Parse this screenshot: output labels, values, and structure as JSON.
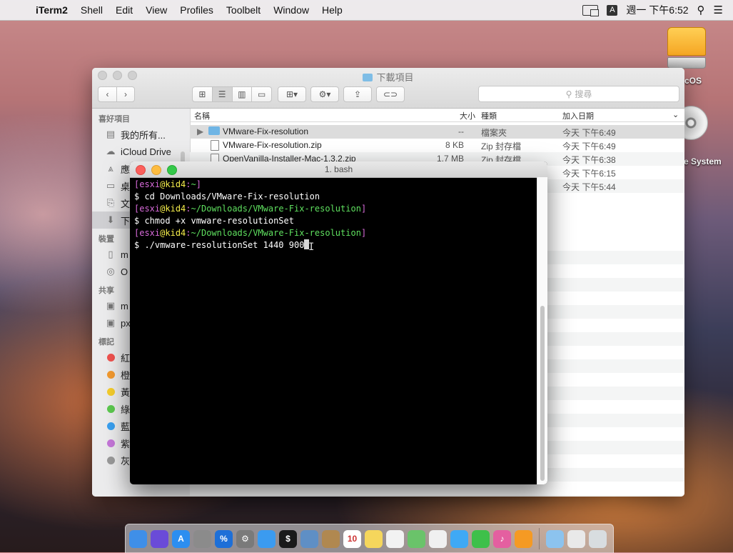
{
  "menubar": {
    "apple": "",
    "app_name": "iTerm2",
    "items": [
      "Shell",
      "Edit",
      "View",
      "Profiles",
      "Toolbelt",
      "Window",
      "Help"
    ],
    "input_method": "A",
    "clock": "週一 下午6:52"
  },
  "desktop": {
    "hd_label": "cOS",
    "disc_label": "e System"
  },
  "finder": {
    "title": "下載項目",
    "search_placeholder": "搜尋",
    "sidebar": {
      "favorites_header": "喜好項目",
      "favorites": [
        "我的所有...",
        "iCloud Drive",
        "應",
        "桌",
        "文",
        "下"
      ],
      "devices_header": "裝置",
      "devices": [
        "m",
        "O"
      ],
      "shared_header": "共享",
      "shared": [
        "m",
        "px"
      ],
      "tags_header": "標記",
      "tags": [
        {
          "label": "紅",
          "color": "#f0524f"
        },
        {
          "label": "橙",
          "color": "#f39a2f"
        },
        {
          "label": "黃",
          "color": "#f5cd2b"
        },
        {
          "label": "綠",
          "color": "#5cc94f"
        },
        {
          "label": "藍",
          "color": "#3aa0f0"
        },
        {
          "label": "紫",
          "color": "#c577d9"
        },
        {
          "label": "灰色",
          "color": "#9a9a9a"
        }
      ]
    },
    "columns": {
      "name": "名稱",
      "size": "大小",
      "kind": "種類",
      "date": "加入日期"
    },
    "files": [
      {
        "name": "VMware-Fix-resolution",
        "size": "--",
        "kind": "檔案夾",
        "date": "今天 下午6:49"
      },
      {
        "name": "VMware-Fix-resolution.zip",
        "size": "8 KB",
        "kind": "Zip 封存檔",
        "date": "今天 下午6:49"
      },
      {
        "name": "OpenVanilla-Installer-Mac-1.3.2.zip",
        "size": "1.7 MB",
        "kind": "Zip 封存檔",
        "date": "今天 下午6:38"
      },
      {
        "name": "",
        "size": "",
        "kind": "",
        "date": "今天 下午6:15"
      },
      {
        "name": "",
        "size": "",
        "kind": "",
        "date": "今天 下午5:44"
      }
    ]
  },
  "terminal": {
    "title": "1. bash",
    "lines": [
      {
        "user": "esxi",
        "host": "kid4",
        "path": "~"
      },
      {
        "cmd": "$ cd Downloads/VMware-Fix-resolution"
      },
      {
        "user": "esxi",
        "host": "kid4",
        "path": "~/Downloads/VMware-Fix-resolution"
      },
      {
        "cmd": "$ chmod +x vmware-resolutionSet"
      },
      {
        "user": "esxi",
        "host": "kid4",
        "path": "~/Downloads/VMware-Fix-resolution"
      },
      {
        "cmd": "$ ./vmware-resolutionSet 1440 900"
      }
    ]
  },
  "dock": {
    "apps": [
      {
        "name": "finder-icon",
        "color": "#3f8fe8",
        "glyph": ""
      },
      {
        "name": "siri-icon",
        "color": "#6a4bd8",
        "glyph": ""
      },
      {
        "name": "app-store-icon",
        "color": "#2c8ef0",
        "glyph": "A"
      },
      {
        "name": "launchpad-icon",
        "color": "#8b8b8b",
        "glyph": ""
      },
      {
        "name": "percent-app-icon",
        "color": "#1e6fd8",
        "glyph": "%"
      },
      {
        "name": "system-preferences-icon",
        "color": "#7a7a7a",
        "glyph": "⚙"
      },
      {
        "name": "safari-icon",
        "color": "#3b9bf0",
        "glyph": ""
      },
      {
        "name": "iterm-icon",
        "color": "#1a1a1a",
        "glyph": "$"
      },
      {
        "name": "preview-icon",
        "color": "#5f8fc5",
        "glyph": ""
      },
      {
        "name": "contacts-icon",
        "color": "#b08850",
        "glyph": ""
      },
      {
        "name": "calendar-icon",
        "color": "#ffffff",
        "glyph": "10"
      },
      {
        "name": "notes-icon",
        "color": "#f5d65c",
        "glyph": ""
      },
      {
        "name": "reminders-icon",
        "color": "#f2f2f2",
        "glyph": ""
      },
      {
        "name": "maps-icon",
        "color": "#6ac36a",
        "glyph": ""
      },
      {
        "name": "photos-icon",
        "color": "#f0f0f0",
        "glyph": ""
      },
      {
        "name": "messages-icon",
        "color": "#3fa9f5",
        "glyph": ""
      },
      {
        "name": "facetime-icon",
        "color": "#3ec04a",
        "glyph": ""
      },
      {
        "name": "itunes-icon",
        "color": "#e45fa0",
        "glyph": "♪"
      },
      {
        "name": "ibooks-icon",
        "color": "#f59a23",
        "glyph": ""
      },
      {
        "name": "downloads-folder-icon",
        "color": "#8cc3ee",
        "glyph": ""
      },
      {
        "name": "documents-icon",
        "color": "#e9e9e9",
        "glyph": ""
      },
      {
        "name": "trash-icon",
        "color": "#d8dde0",
        "glyph": ""
      }
    ]
  }
}
